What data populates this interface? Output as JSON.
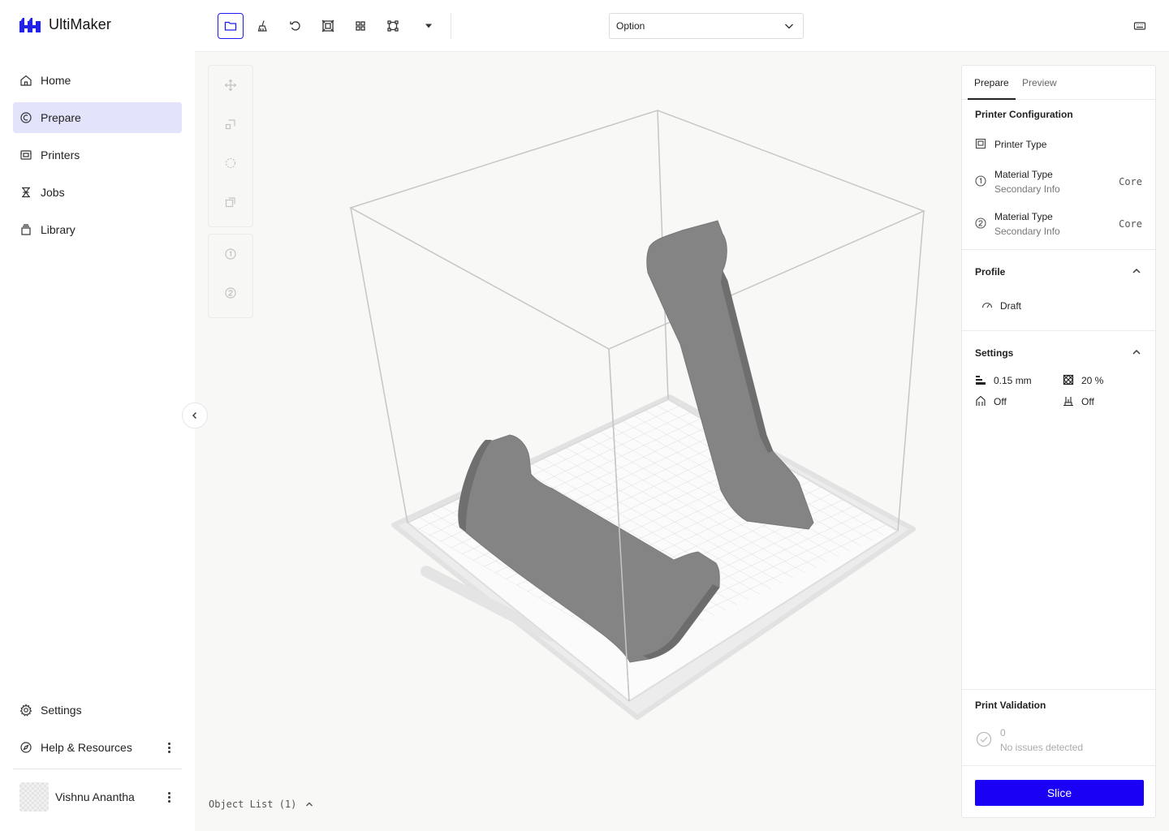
{
  "brand": {
    "name": "UltiMaker"
  },
  "nav": {
    "items": [
      {
        "label": "Home"
      },
      {
        "label": "Prepare"
      },
      {
        "label": "Printers"
      },
      {
        "label": "Jobs"
      },
      {
        "label": "Library"
      }
    ],
    "active": "Prepare",
    "bottom": [
      {
        "label": "Settings"
      },
      {
        "label": "Help & Resources"
      }
    ]
  },
  "user": {
    "name": "Vishnu Anantha"
  },
  "toolbar": {
    "select_value": "Option",
    "buttons": [
      "open-folder",
      "clean-plate",
      "undo",
      "fit-to-view",
      "arrange",
      "select-frame",
      "more-dropdown"
    ],
    "selected": "open-folder"
  },
  "viewport": {
    "object_list": "Object List (1)"
  },
  "panel": {
    "tabs": {
      "prepare": "Prepare",
      "preview": "Preview",
      "active": "Prepare"
    },
    "printer_config": {
      "title": "Printer Configuration",
      "printer_type": "Printer Type",
      "extruders": [
        {
          "title": "Material Type",
          "sub": "Secondary Info",
          "core": "Core"
        },
        {
          "title": "Material Type",
          "sub": "Secondary Info",
          "core": "Core"
        }
      ]
    },
    "profile": {
      "title": "Profile",
      "value": "Draft"
    },
    "settings": {
      "title": "Settings",
      "layer_height": "0.15 mm",
      "infill": "20 %",
      "support": "Off",
      "adhesion": "Off"
    },
    "validation": {
      "title": "Print Validation",
      "count": "0",
      "message": "No issues detected"
    },
    "slice_label": "Slice"
  },
  "colors": {
    "accent": "#1a00f5",
    "active_nav_bg": "#e3e3fb",
    "model": "#848484"
  }
}
